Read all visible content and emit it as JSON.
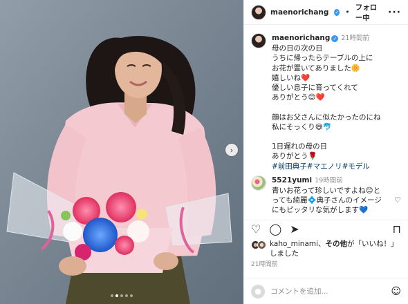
{
  "header": {
    "username": "maenorichang",
    "separator": "•",
    "follow_label": "フォロー中",
    "more_label": "···"
  },
  "caption": {
    "username": "maenorichang",
    "time": "21時間前",
    "lines": [
      "母の日の次の日",
      "うちに帰ったらテーブルの上に",
      "お花が置いてありました🌼",
      "嬉しいね❤️",
      "優しい息子に育ってくれて",
      "ありがとう😊❤️",
      "",
      "顔はお父さんに似たかったのにね",
      "私にそっくり😅🐬",
      "",
      "1日遅れの母の日",
      "ありがとう🌹"
    ],
    "hashtags": "#前田典子#マエノリ#モデル"
  },
  "comment": {
    "username": "5521yumi",
    "time": "19時間前",
    "lines": [
      "青いお花って珍しいですよね😊と",
      "っても綺麗💠典子さんのイメージ",
      "にもピッタリな気がします💙"
    ]
  },
  "actions": {
    "like_icon": "♡",
    "comment_icon": "◯",
    "share_icon": "➤",
    "save_icon": "⊓"
  },
  "likes": {
    "liker": "kaho_minami",
    "connector": "、",
    "others": "その他",
    "suffix": "が「いいね！」",
    "line2": "しました"
  },
  "timestamp": "21時間前",
  "comment_box": {
    "placeholder": "コメントを追加...",
    "emoji_icon": "☺"
  },
  "media": {
    "next_arrow": "›",
    "dots_total": 5,
    "dots_active": 2
  },
  "colors": {
    "accent": "#3897f0",
    "hashtag": "#00376b",
    "muted": "#8e8e8e"
  }
}
